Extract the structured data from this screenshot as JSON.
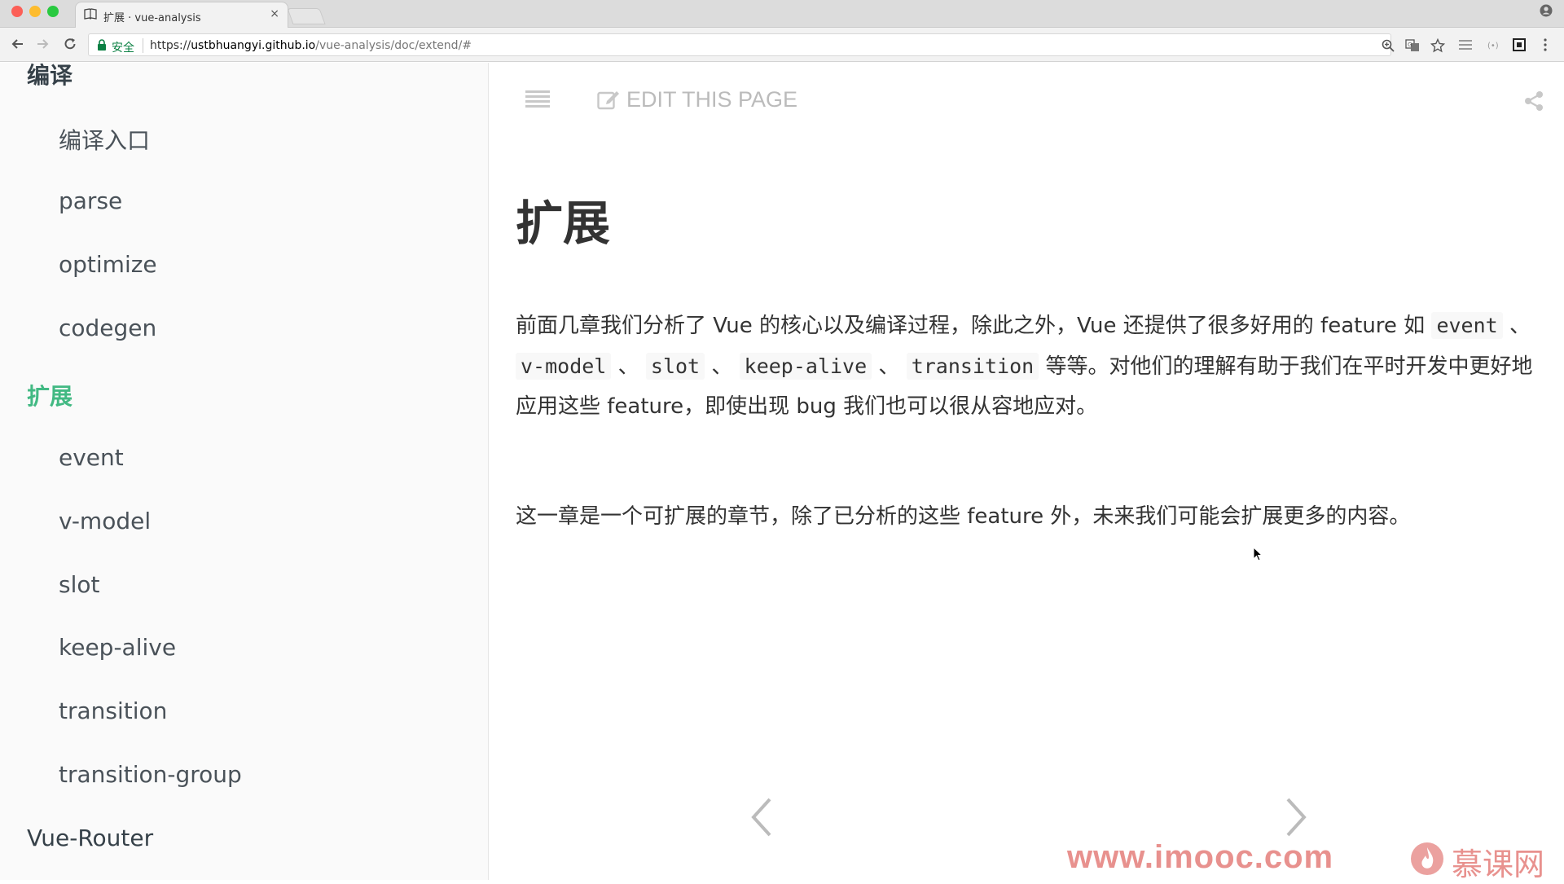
{
  "browser": {
    "tab_title": "扩展 · vue-analysis",
    "tab_close": "×",
    "secure_label": "安全",
    "url_scheme": "https://",
    "url_host": "ustbhuangyi.github.io",
    "url_path": "/vue-analysis/doc/extend/#"
  },
  "sidebar": {
    "items": [
      {
        "label": "编译",
        "level": "chapter"
      },
      {
        "label": "编译入口",
        "level": "sub"
      },
      {
        "label": "parse",
        "level": "sub"
      },
      {
        "label": "optimize",
        "level": "sub"
      },
      {
        "label": "codegen",
        "level": "sub"
      },
      {
        "label": "扩展",
        "level": "chapter",
        "active": true
      },
      {
        "label": "event",
        "level": "sub"
      },
      {
        "label": "v-model",
        "level": "sub"
      },
      {
        "label": "slot",
        "level": "sub"
      },
      {
        "label": "keep-alive",
        "level": "sub"
      },
      {
        "label": "transition",
        "level": "sub"
      },
      {
        "label": "transition-group",
        "level": "sub"
      },
      {
        "label": "Vue-Router",
        "level": "chapter"
      }
    ]
  },
  "header": {
    "edit_label": "EDIT THIS PAGE"
  },
  "article": {
    "title": "扩展",
    "p1_a": "前面几章我们分析了 Vue 的核心以及编译过程，除此之外，Vue 还提供了很多好用的 feature 如 ",
    "code1": "event",
    "sep1": " 、 ",
    "code2": "v-model",
    "sep2": " 、 ",
    "code3": "slot",
    "sep3": " 、 ",
    "code4": "keep-alive",
    "sep4": " 、 ",
    "code5": "transition",
    "p1_b": " 等等。对他们的理解有助于我们在平时开发中更好地应用这些 feature，即使出现 bug 我们也可以很从容地应对。",
    "p2": "这一章是一个可扩展的章节，除了已分析的这些 feature 外，未来我们可能会扩展更多的内容。"
  },
  "watermark": {
    "url": "www.imooc.com",
    "brand": "慕课网"
  },
  "colors": {
    "accent": "#42b983",
    "text": "#333333",
    "sidebar_bg": "#fafafa"
  }
}
